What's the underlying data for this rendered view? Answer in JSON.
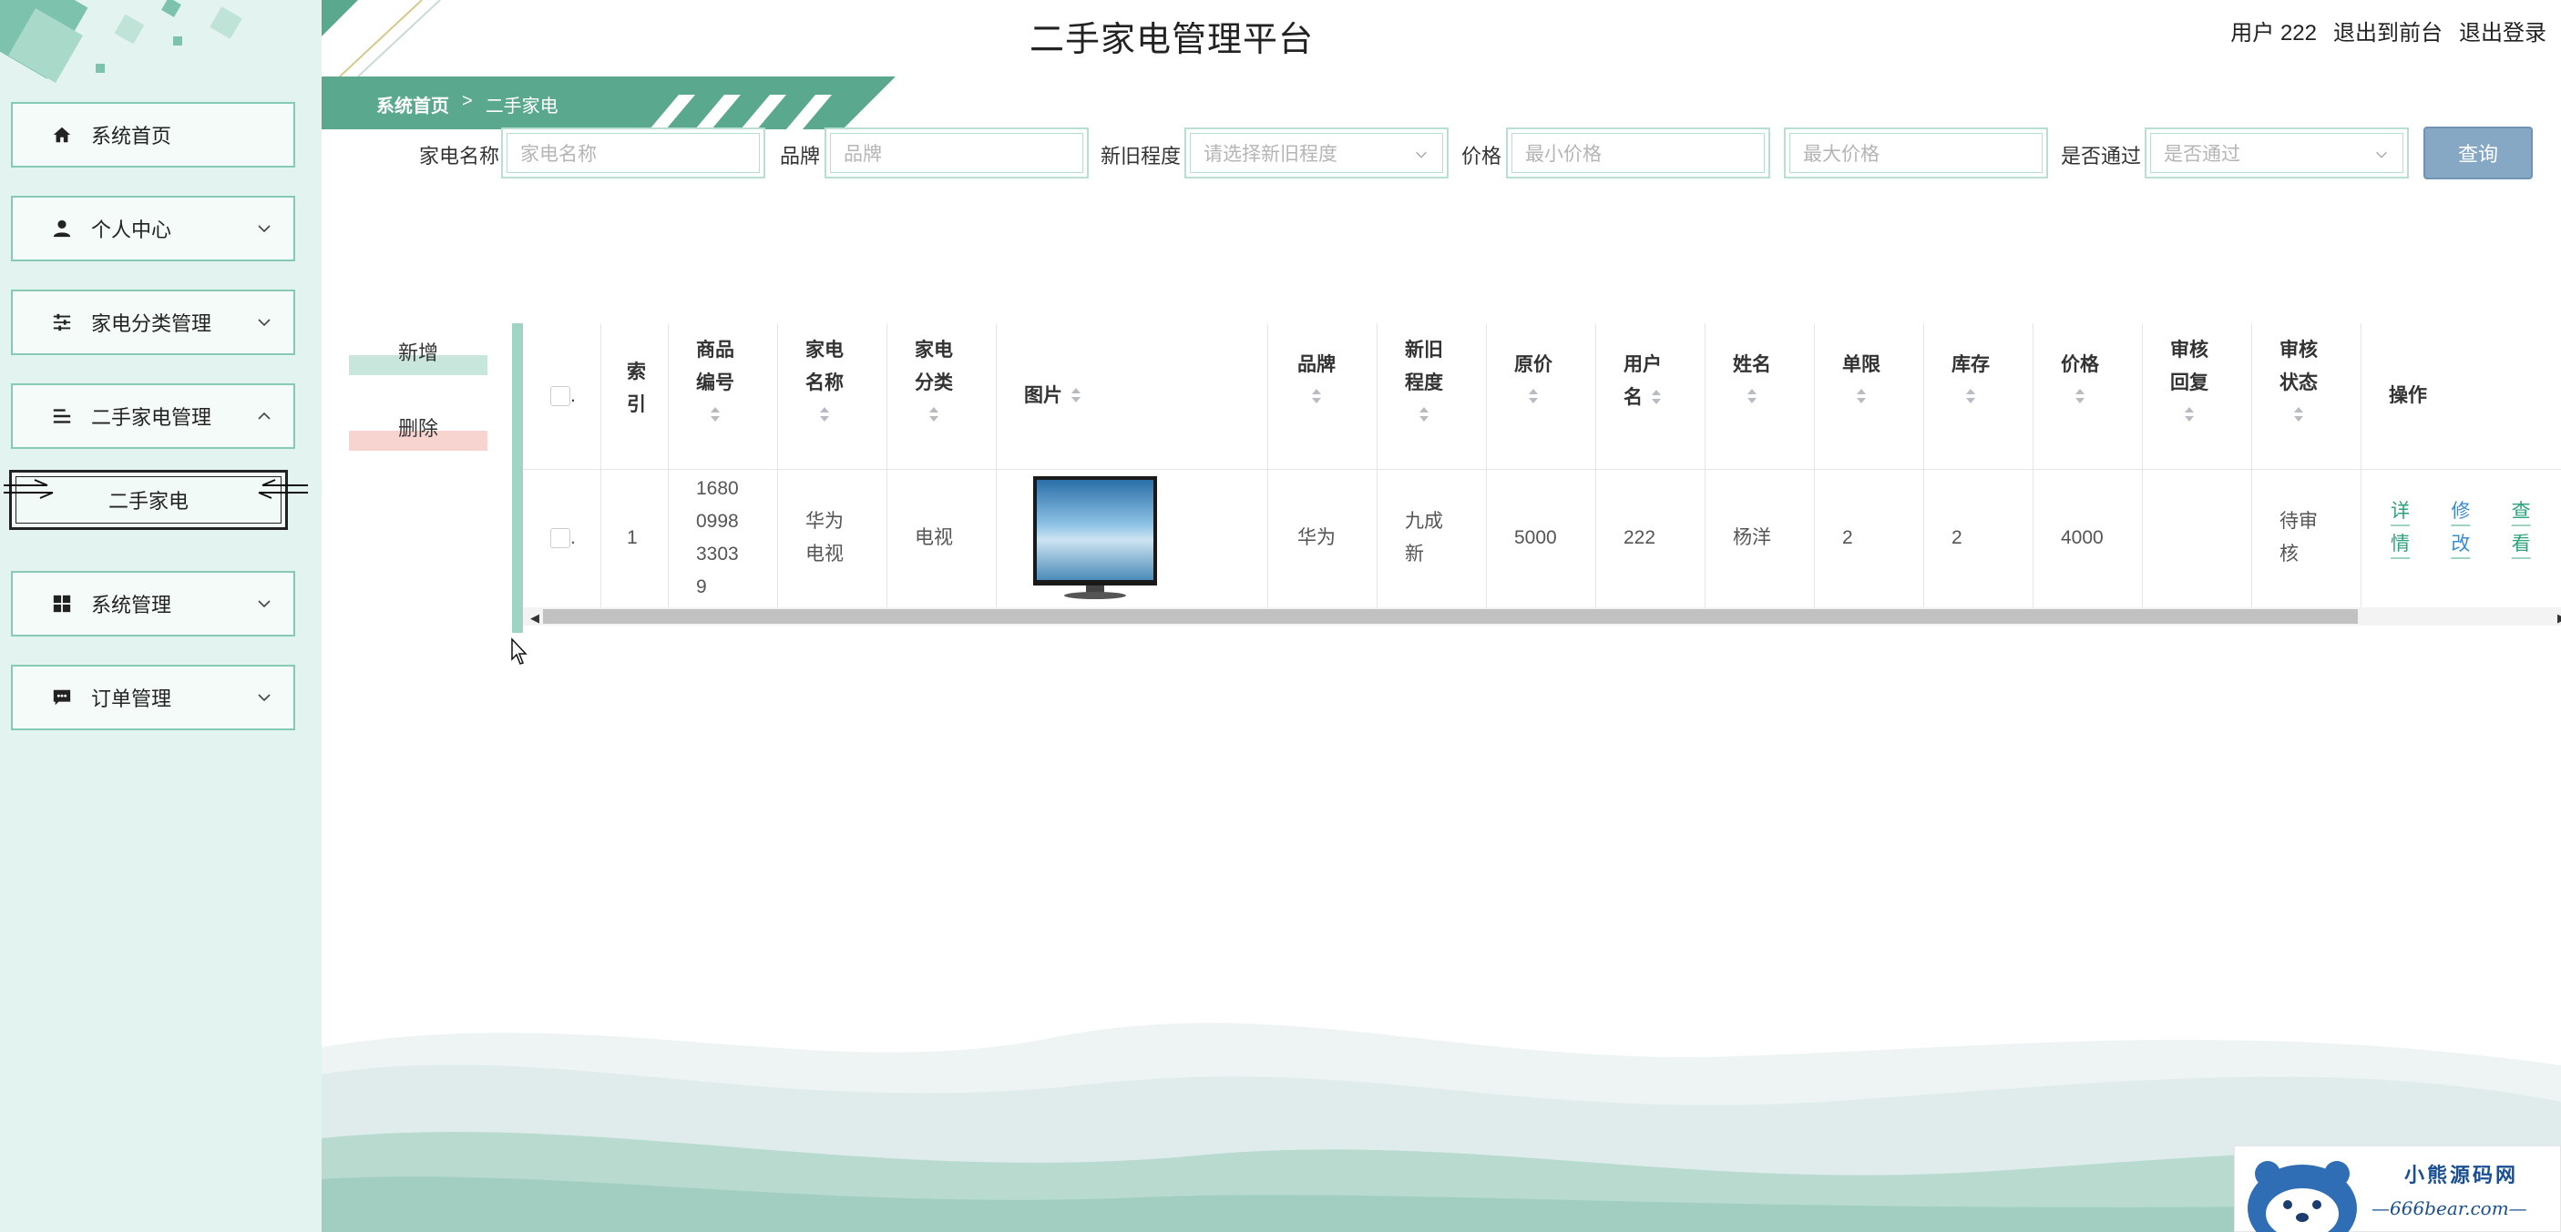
{
  "app": {
    "title": "二手家电管理平台"
  },
  "user_area": {
    "user_label": "用户 222",
    "to_front": "退出到前台",
    "logout": "退出登录"
  },
  "breadcrumb": {
    "home": "系统首页",
    "sep": ">",
    "current": "二手家电"
  },
  "sidebar": {
    "items": [
      {
        "label": "系统首页",
        "icon": "home-icon"
      },
      {
        "label": "个人中心",
        "icon": "user-icon"
      },
      {
        "label": "家电分类管理",
        "icon": "sliders-icon"
      },
      {
        "label": "二手家电管理",
        "icon": "list-icon"
      },
      {
        "label": "系统管理",
        "icon": "grid-icon"
      },
      {
        "label": "订单管理",
        "icon": "chat-icon"
      }
    ],
    "sub_item": "二手家电"
  },
  "search": {
    "name_label": "家电名称",
    "name_placeholder": "家电名称",
    "brand_label": "品牌",
    "brand_placeholder": "品牌",
    "condition_label": "新旧程度",
    "condition_placeholder": "请选择新旧程度",
    "price_label": "价格",
    "min_price_placeholder": "最小价格",
    "max_price_placeholder": "最大价格",
    "passed_label": "是否通过",
    "passed_placeholder": "是否通过",
    "query_button": "查询"
  },
  "actions": {
    "add": "新增",
    "delete": "删除"
  },
  "table": {
    "headers": {
      "index": [
        "索",
        "引"
      ],
      "code": [
        "商品",
        "编号"
      ],
      "name": [
        "家电",
        "名称"
      ],
      "category": [
        "家电",
        "分类"
      ],
      "image": "图片",
      "brand": "品牌",
      "condition": [
        "新旧",
        "程度"
      ],
      "orig_price": "原价",
      "username": [
        "用户",
        "名"
      ],
      "realname": "姓名",
      "limit": "单限",
      "stock": "库存",
      "price": "价格",
      "review_reply": [
        "审核",
        "回复"
      ],
      "review_status": [
        "审核",
        "状态"
      ],
      "ops": "操作"
    },
    "row": {
      "index": "1",
      "code": [
        "1680",
        "0998",
        "3303",
        "9"
      ],
      "name": [
        "华为",
        "电视"
      ],
      "category": "电视",
      "brand": "华为",
      "condition": [
        "九成",
        "新"
      ],
      "orig_price": "5000",
      "username": "222",
      "realname": "杨洋",
      "limit": "2",
      "stock": "2",
      "price": "4000",
      "review_reply": "",
      "review_status": [
        "待审",
        "核"
      ],
      "ops": {
        "detail": "详情",
        "edit": "修改",
        "view": "查看"
      }
    }
  },
  "watermark": {
    "title": "小熊源码网",
    "url": "—666bear.com—"
  },
  "colors": {
    "sidebar_bg": "#e3f3ef",
    "accent_green": "#5aa88e",
    "query_btn": "#86a8c5",
    "link_blue": "#3a8ccf"
  }
}
